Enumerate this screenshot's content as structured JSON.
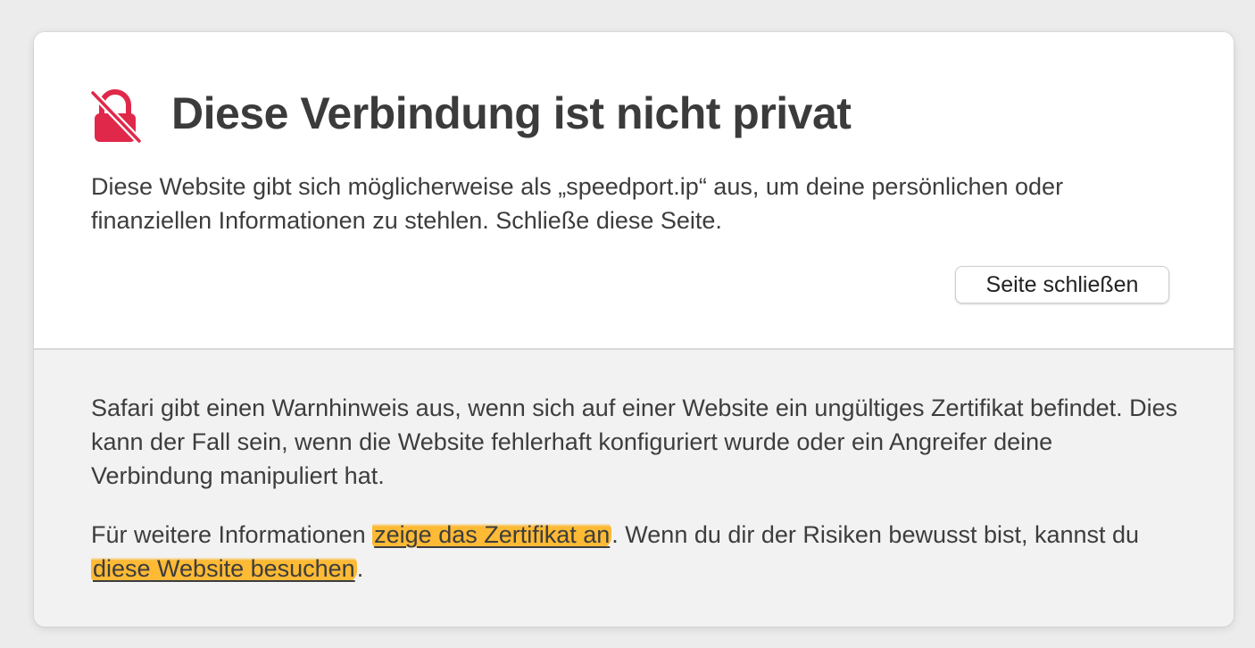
{
  "header": {
    "title": "Diese Verbindung ist nicht privat",
    "warning": "Diese Website gibt sich möglicherweise als „speedport.ip“ aus, um deine persönlichen oder finanziellen Informationen zu stehlen. Schließe diese Seite.",
    "close_button_label": "Seite schließen",
    "icon": "lock-broken-icon",
    "accent_color": "#e0284a"
  },
  "details": {
    "paragraph": "Safari gibt einen Warnhinweis aus, wenn sich auf einer Website ein ungültiges Zertifikat befindet. Dies kann der Fall sein, wenn die Website fehlerhaft konfiguriert wurde oder ein Angreifer deine Verbindung manipuliert hat.",
    "more_info_prefix": "Für weitere Informationen ",
    "show_certificate_link": "zeige das Zertifikat an",
    "more_info_middle": ". Wenn du dir der Risiken bewusst bist, kannst du ",
    "visit_website_link": "diese Website besuchen",
    "more_info_suffix": ".",
    "highlight_color": "#ffb014"
  }
}
